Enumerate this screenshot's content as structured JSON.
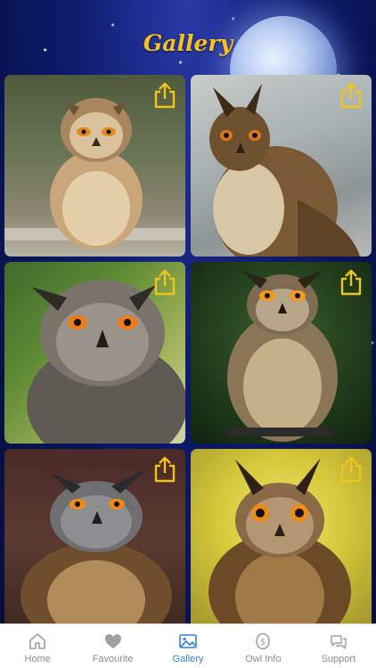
{
  "header": {
    "title": "Gallery"
  },
  "gallery": {
    "items": [
      {
        "image": "owl-on-log",
        "share_icon": "share-icon"
      },
      {
        "image": "owl-grey-background",
        "share_icon": "share-icon"
      },
      {
        "image": "owl-closeup-green",
        "share_icon": "share-icon"
      },
      {
        "image": "owl-dark-green",
        "share_icon": "share-icon"
      },
      {
        "image": "owl-brown-background",
        "share_icon": "share-icon"
      },
      {
        "image": "owl-yellow-background",
        "share_icon": "share-icon"
      }
    ]
  },
  "tabbar": {
    "tabs": [
      {
        "label": "Home",
        "icon": "home-icon",
        "active": false
      },
      {
        "label": "Favourite",
        "icon": "heart-icon",
        "active": false
      },
      {
        "label": "Gallery",
        "icon": "gallery-icon",
        "active": true
      },
      {
        "label": "Owl Info",
        "icon": "info-icon",
        "active": false
      },
      {
        "label": "Support",
        "icon": "support-icon",
        "active": false
      }
    ]
  },
  "colors": {
    "title": "#f7c21b",
    "share_icon": "#f2c41a",
    "tab_active": "#2f7fe6",
    "tab_inactive": "#8e8e93"
  }
}
